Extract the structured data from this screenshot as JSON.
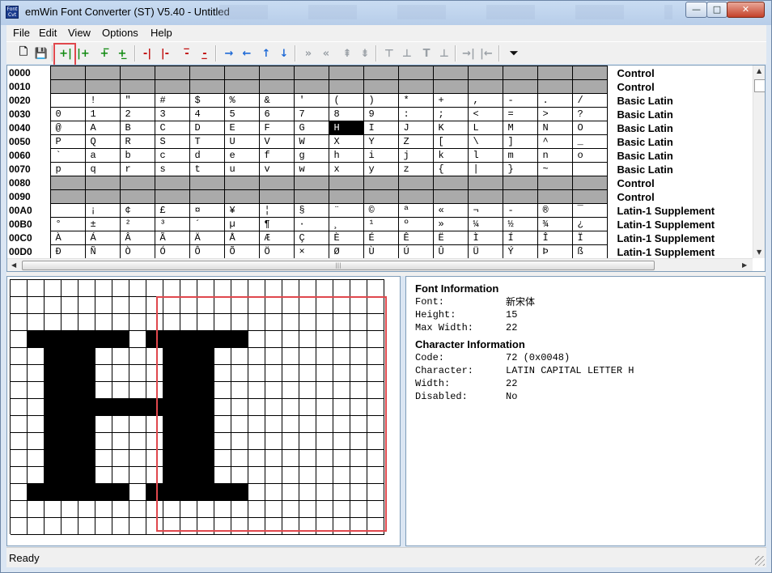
{
  "window": {
    "title": "emWin Font Converter (ST) V5.40 - Untitled",
    "icon_label": "Font Cvt",
    "buttons": {
      "minimize": "—",
      "maximize": "□",
      "close": "✕"
    }
  },
  "menu": [
    "File",
    "Edit",
    "View",
    "Options",
    "Help"
  ],
  "toolbar": [
    {
      "name": "new-icon",
      "glyph": "🗋",
      "color": "black"
    },
    {
      "name": "save-icon",
      "glyph": "💾",
      "color": "black"
    },
    {
      "name": "enable-char-icon",
      "glyph": "+|",
      "color": "green"
    },
    {
      "name": "enable-range-icon",
      "glyph": "|+",
      "color": "green"
    },
    {
      "name": "enable-block-up-icon",
      "glyph": "+̅",
      "color": "green"
    },
    {
      "name": "enable-block-down-icon",
      "glyph": "+̲",
      "color": "green"
    },
    {
      "name": "disable-char-icon",
      "glyph": "-|",
      "color": "red"
    },
    {
      "name": "disable-range-icon",
      "glyph": "|-",
      "color": "red"
    },
    {
      "name": "disable-block-up-icon",
      "glyph": "-̅",
      "color": "red"
    },
    {
      "name": "disable-block-down-icon",
      "glyph": "-̲",
      "color": "red"
    },
    {
      "name": "arrow-right-icon",
      "glyph": "→",
      "color": "blue"
    },
    {
      "name": "arrow-left-icon",
      "glyph": "←",
      "color": "blue"
    },
    {
      "name": "arrow-up-icon",
      "glyph": "↑",
      "color": "blue"
    },
    {
      "name": "arrow-down-icon",
      "glyph": "↓",
      "color": "blue"
    },
    {
      "name": "fast-forward-icon",
      "glyph": "»",
      "color": "gray"
    },
    {
      "name": "fast-back-icon",
      "glyph": "«",
      "color": "gray"
    },
    {
      "name": "page-up-icon",
      "glyph": "⇞",
      "color": "gray"
    },
    {
      "name": "page-down-icon",
      "glyph": "⇟",
      "color": "gray"
    },
    {
      "name": "top-icon",
      "glyph": "⊤",
      "color": "gray"
    },
    {
      "name": "bottom-icon",
      "glyph": "⊥",
      "color": "gray"
    },
    {
      "name": "move-top-icon",
      "glyph": "T",
      "color": "gray"
    },
    {
      "name": "move-bottom-icon",
      "glyph": "⊥",
      "color": "gray"
    },
    {
      "name": "shift-right-icon",
      "glyph": "→|",
      "color": "gray"
    },
    {
      "name": "shift-left-icon",
      "glyph": "|←",
      "color": "gray"
    },
    {
      "name": "filter-icon",
      "glyph": "⏷",
      "color": "black"
    }
  ],
  "char_table": {
    "rows": [
      {
        "code": "0000",
        "block": "Control",
        "control": true,
        "cells": []
      },
      {
        "code": "0010",
        "block": "Control",
        "control": true,
        "cells": []
      },
      {
        "code": "0020",
        "block": "Basic Latin",
        "cells": [
          "",
          "!",
          "\"",
          "#",
          "$",
          "%",
          "&",
          "'",
          "(",
          ")",
          "*",
          "+",
          ",",
          "-",
          ".",
          "/"
        ]
      },
      {
        "code": "0030",
        "block": "Basic Latin",
        "cells": [
          "0",
          "1",
          "2",
          "3",
          "4",
          "5",
          "6",
          "7",
          "8",
          "9",
          ":",
          ";",
          "<",
          "=",
          ">",
          "?"
        ]
      },
      {
        "code": "0040",
        "block": "Basic Latin",
        "cells": [
          "@",
          "A",
          "B",
          "C",
          "D",
          "E",
          "F",
          "G",
          "H",
          "I",
          "J",
          "K",
          "L",
          "M",
          "N",
          "O"
        ]
      },
      {
        "code": "0050",
        "block": "Basic Latin",
        "cells": [
          "P",
          "Q",
          "R",
          "S",
          "T",
          "U",
          "V",
          "W",
          "X",
          "Y",
          "Z",
          "[",
          "\\",
          "]",
          "^",
          "_"
        ]
      },
      {
        "code": "0060",
        "block": "Basic Latin",
        "cells": [
          "`",
          "a",
          "b",
          "c",
          "d",
          "e",
          "f",
          "g",
          "h",
          "i",
          "j",
          "k",
          "l",
          "m",
          "n",
          "o"
        ]
      },
      {
        "code": "0070",
        "block": "Basic Latin",
        "cells": [
          "p",
          "q",
          "r",
          "s",
          "t",
          "u",
          "v",
          "w",
          "x",
          "y",
          "z",
          "{",
          "|",
          "}",
          "~",
          ""
        ]
      },
      {
        "code": "0080",
        "block": "Control",
        "control": true,
        "cells": []
      },
      {
        "code": "0090",
        "block": "Control",
        "control": true,
        "cells": []
      },
      {
        "code": "00A0",
        "block": "Latin-1 Supplement",
        "cells": [
          "",
          "¡",
          "¢",
          "£",
          "¤",
          "¥",
          "¦",
          "§",
          "¨",
          "©",
          "ª",
          "«",
          "¬",
          "-",
          "®",
          "¯"
        ]
      },
      {
        "code": "00B0",
        "block": "Latin-1 Supplement",
        "cells": [
          "°",
          "±",
          "²",
          "³",
          "´",
          "µ",
          "¶",
          "·",
          "¸",
          "¹",
          "º",
          "»",
          "¼",
          "½",
          "¾",
          "¿"
        ]
      },
      {
        "code": "00C0",
        "block": "Latin-1 Supplement",
        "cells": [
          "À",
          "Á",
          "Â",
          "Ã",
          "Ä",
          "Å",
          "Æ",
          "Ç",
          "È",
          "É",
          "Ê",
          "Ë",
          "Ì",
          "Í",
          "Î",
          "Ï"
        ]
      },
      {
        "code": "00D0",
        "block": "Latin-1 Supplement",
        "cells": [
          "Ð",
          "Ñ",
          "Ò",
          "Ó",
          "Ô",
          "Õ",
          "Ö",
          "×",
          "Ø",
          "Ù",
          "Ú",
          "Û",
          "Ü",
          "Ý",
          "Þ",
          "ß"
        ]
      }
    ],
    "selected": {
      "row": 4,
      "col": 8
    }
  },
  "pixel_editor": {
    "cols": 22,
    "rows": 15,
    "bitmap": [
      "0000000000000000000000",
      "0000000000000000000000",
      "0000000000000000000000",
      "0111111011111100000000",
      "0011100001110000000000",
      "0011100001110000000000",
      "0011100001110000000000",
      "0011111111110000000000",
      "0011100001110000000000",
      "0011100001110000000000",
      "0011100001110000000000",
      "0011100001110000000000",
      "0111111011111100000000",
      "0000000000000000000000",
      "0000000000000000000000"
    ]
  },
  "font_info": {
    "heading": "Font Information",
    "rows": [
      {
        "label": "Font:",
        "value": "新宋体"
      },
      {
        "label": "Height:",
        "value": "15"
      },
      {
        "label": "Max Width:",
        "value": "22"
      }
    ]
  },
  "char_info": {
    "heading": "Character Information",
    "rows": [
      {
        "label": "Code:",
        "value": "72 (0x0048)"
      },
      {
        "label": "Character:",
        "value": "LATIN CAPITAL LETTER H"
      },
      {
        "label": "Width:",
        "value": "22"
      },
      {
        "label": "Disabled:",
        "value": "No"
      }
    ]
  },
  "status": "Ready"
}
